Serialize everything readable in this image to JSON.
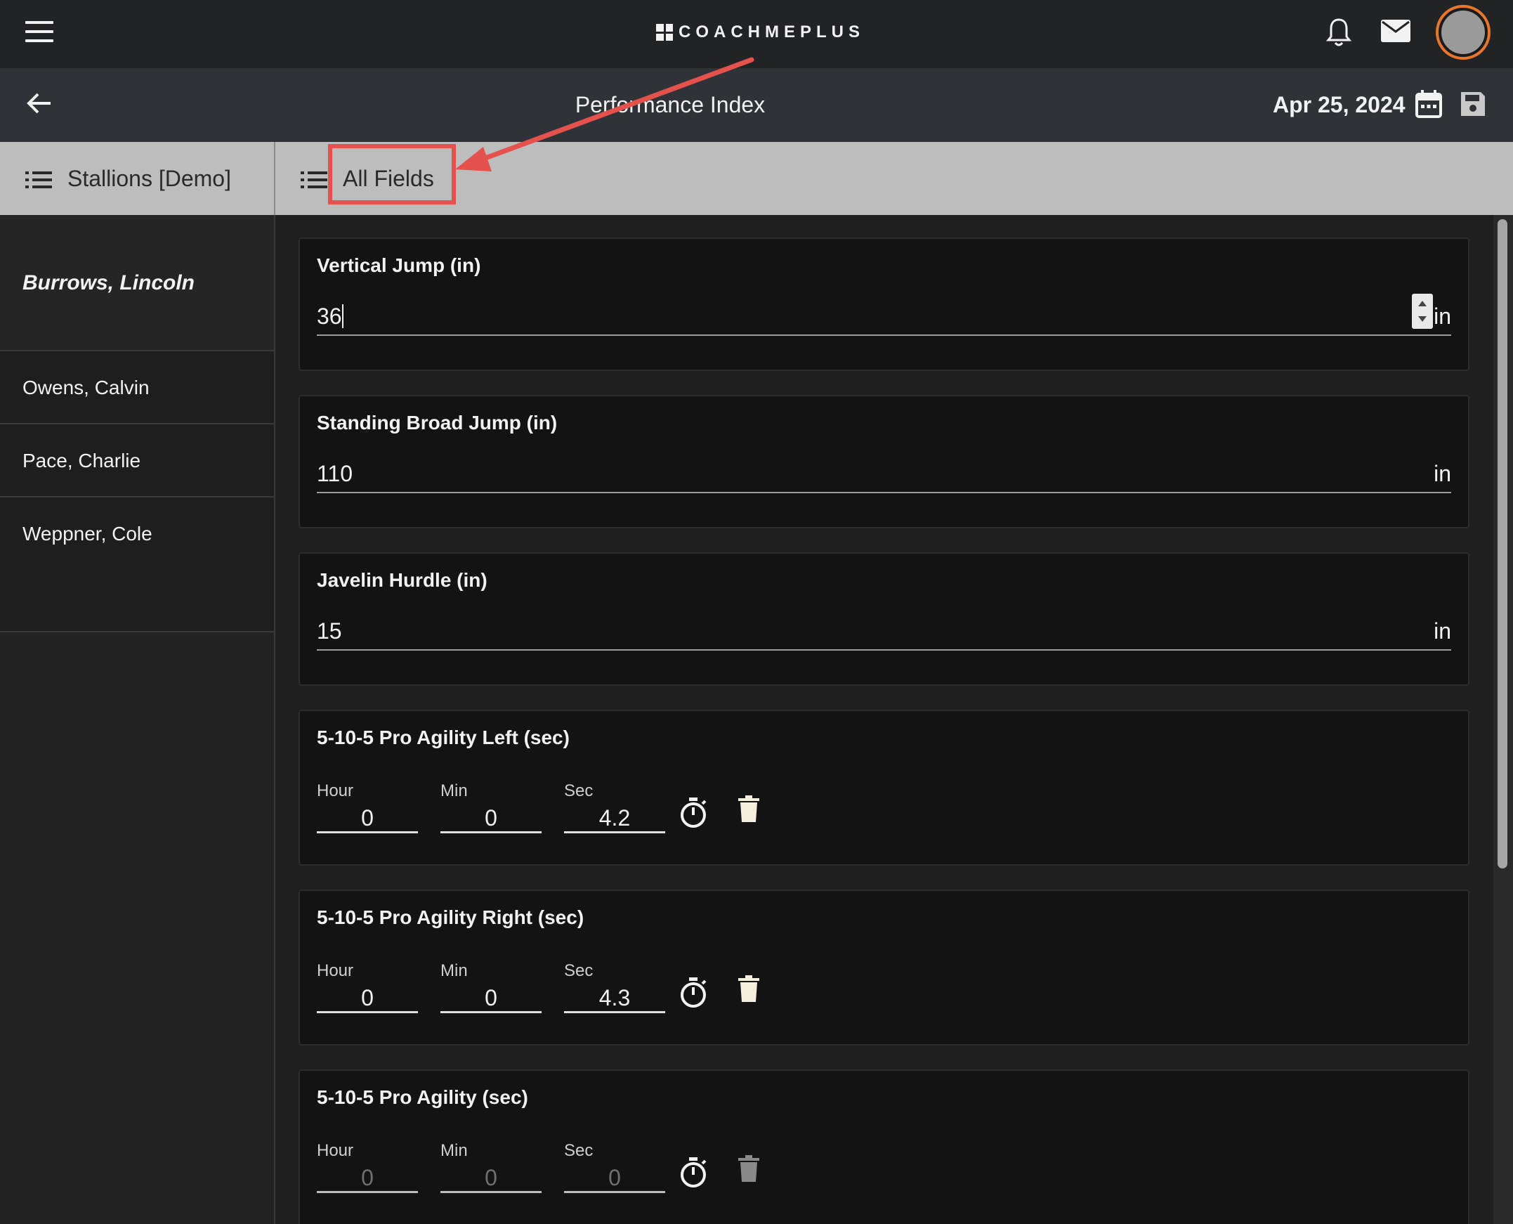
{
  "app": {
    "logo_text": "COACHMEPLUS"
  },
  "header": {
    "page_title": "Performance Index",
    "date": "Apr 25, 2024"
  },
  "filters": {
    "team": "Stallions [Demo]",
    "fields": "All Fields"
  },
  "athletes": {
    "selected": "Burrows, Lincoln",
    "others": [
      "Owens, Calvin",
      "Pace, Charlie",
      "Weppner, Cole"
    ]
  },
  "measurements": [
    {
      "title": "Vertical Jump (in)",
      "value": "36",
      "unit": "in"
    },
    {
      "title": "Standing Broad Jump (in)",
      "value": "110",
      "unit": "in"
    },
    {
      "title": "Javelin Hurdle (in)",
      "value": "15",
      "unit": "in"
    }
  ],
  "timers": [
    {
      "title": "5-10-5 Pro Agility Left (sec)",
      "hour": "0",
      "min": "0",
      "sec": "4.2"
    },
    {
      "title": "5-10-5 Pro Agility Right (sec)",
      "hour": "0",
      "min": "0",
      "sec": "4.3"
    },
    {
      "title": "5-10-5 Pro Agility (sec)",
      "hour": "0",
      "min": "0",
      "sec": "0"
    }
  ],
  "timer_labels": {
    "hour": "Hour",
    "min": "Min",
    "sec": "Sec"
  },
  "colors": {
    "accent_avatar_ring": "#e8762b",
    "annotation": "#e5524e"
  },
  "icons": [
    "menu-icon",
    "bell-icon",
    "mail-icon",
    "back-arrow-icon",
    "calendar-icon",
    "save-icon",
    "list-icon",
    "stopwatch-icon",
    "trash-icon"
  ]
}
